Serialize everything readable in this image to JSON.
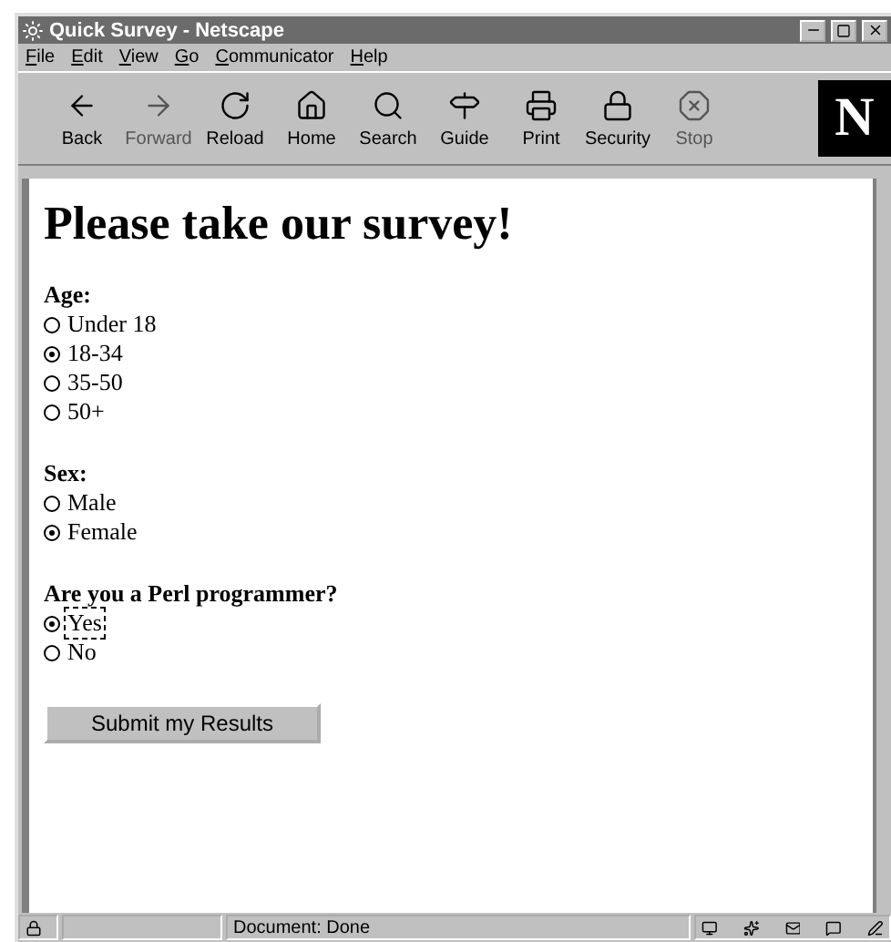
{
  "window": {
    "title": "Quick Survey - Netscape"
  },
  "menu": [
    "File",
    "Edit",
    "View",
    "Go",
    "Communicator",
    "Help"
  ],
  "toolbar": [
    {
      "label": "Back",
      "kind": "back",
      "disabled": false
    },
    {
      "label": "Forward",
      "kind": "forward",
      "disabled": true
    },
    {
      "label": "Reload",
      "kind": "reload",
      "disabled": false
    },
    {
      "label": "Home",
      "kind": "home",
      "disabled": false
    },
    {
      "label": "Search",
      "kind": "search",
      "disabled": false
    },
    {
      "label": "Guide",
      "kind": "guide",
      "disabled": false
    },
    {
      "label": "Print",
      "kind": "print",
      "disabled": false
    },
    {
      "label": "Security",
      "kind": "security",
      "disabled": false
    },
    {
      "label": "Stop",
      "kind": "stop",
      "disabled": true
    }
  ],
  "logo": "N",
  "page": {
    "heading": "Please take our survey!",
    "questions": [
      {
        "label": "Age:",
        "options": [
          {
            "label": "Under 18",
            "selected": false,
            "focused": false
          },
          {
            "label": "18-34",
            "selected": true,
            "focused": false
          },
          {
            "label": "35-50",
            "selected": false,
            "focused": false
          },
          {
            "label": "50+",
            "selected": false,
            "focused": false
          }
        ]
      },
      {
        "label": "Sex:",
        "options": [
          {
            "label": "Male",
            "selected": false,
            "focused": false
          },
          {
            "label": "Female",
            "selected": true,
            "focused": false
          }
        ]
      },
      {
        "label": "Are you a Perl programmer?",
        "options": [
          {
            "label": "Yes",
            "selected": true,
            "focused": true
          },
          {
            "label": "No",
            "selected": false,
            "focused": false
          }
        ]
      }
    ],
    "submit": "Submit my Results"
  },
  "status_bar": {
    "text": "Document: Done"
  }
}
